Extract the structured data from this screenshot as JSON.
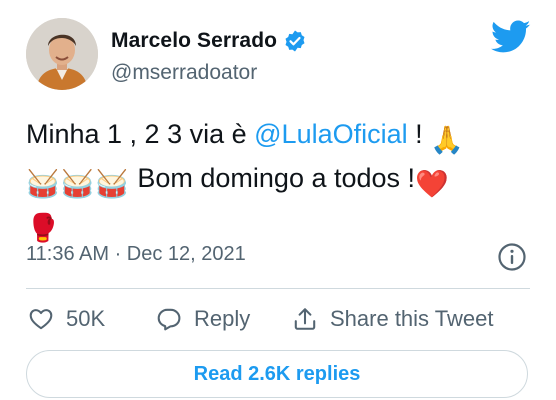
{
  "author": {
    "name": "Marcelo Serrado",
    "handle": "@mserradoator"
  },
  "tweet": {
    "text_part1": "Minha 1 , 2 3 via è ",
    "mention": "@LulaOficial",
    "text_part2": " ! ",
    "text_part3": " Bom domingo a todos !"
  },
  "emoji": {
    "praying_hands": "🙏",
    "drum": "🥁",
    "heart": "❤️",
    "boxing_glove": "🥊"
  },
  "timestamp": "11:36 AM · Dec 12, 2021",
  "actions": {
    "like_count": "50K",
    "reply_label": "Reply",
    "share_label": "Share this Tweet"
  },
  "read_replies_label": "Read 2.6K replies",
  "colors": {
    "accent": "#1d9bf0",
    "text": "#0f1419",
    "secondary": "#536471",
    "border": "#cfd9de"
  }
}
